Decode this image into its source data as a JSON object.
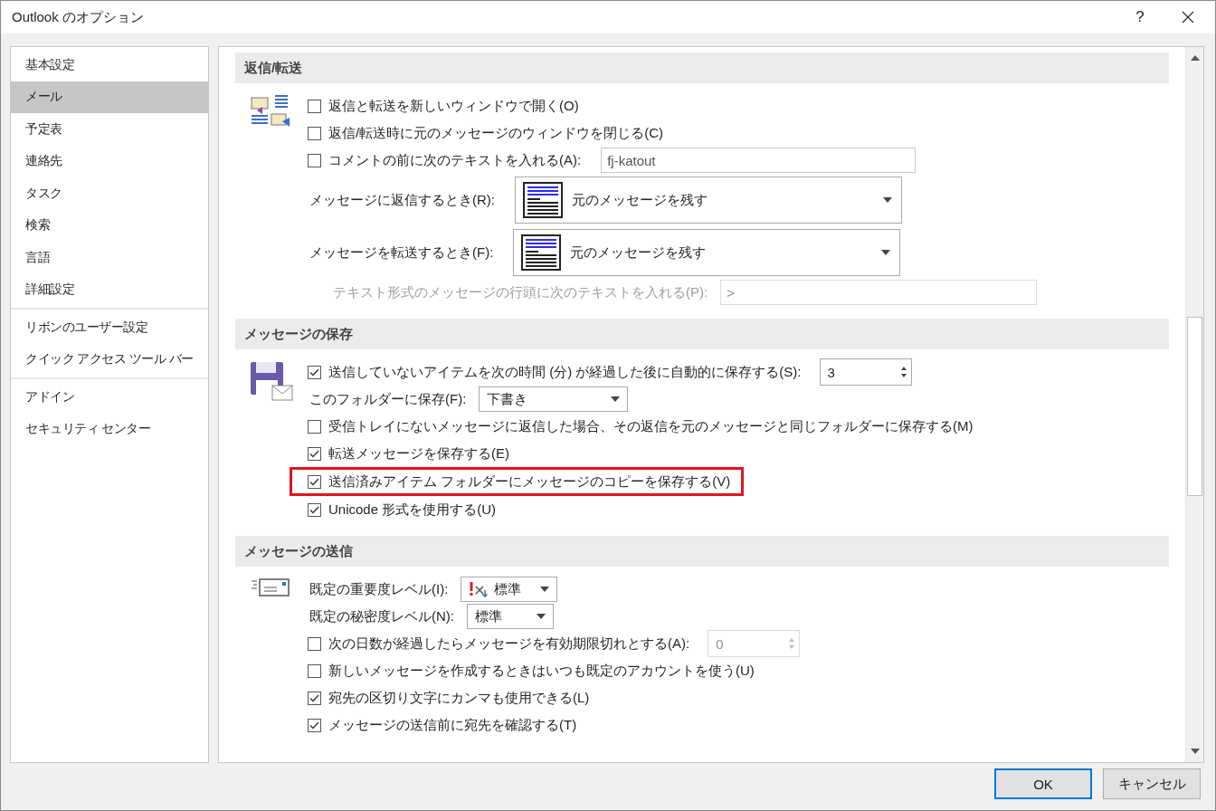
{
  "window": {
    "title": "Outlook のオプション",
    "help": "?"
  },
  "sidebar": {
    "groups": [
      {
        "items": [
          {
            "label": "基本設定",
            "selected": false
          },
          {
            "label": "メール",
            "selected": true
          },
          {
            "label": "予定表",
            "selected": false
          },
          {
            "label": "連絡先",
            "selected": false
          },
          {
            "label": "タスク",
            "selected": false
          },
          {
            "label": "検索",
            "selected": false
          },
          {
            "label": "言語",
            "selected": false
          },
          {
            "label": "詳細設定",
            "selected": false
          }
        ]
      },
      {
        "items": [
          {
            "label": "リボンのユーザー設定",
            "selected": false
          },
          {
            "label": "クイック アクセス ツール バー",
            "selected": false
          }
        ]
      },
      {
        "items": [
          {
            "label": "アドイン",
            "selected": false
          },
          {
            "label": "セキュリティ センター",
            "selected": false
          }
        ]
      }
    ]
  },
  "sections": [
    {
      "title": "返信/転送",
      "rows": [
        {
          "kind": "check",
          "label": "返信と転送を新しいウィンドウで開く(O)",
          "checked": false
        },
        {
          "kind": "check",
          "label": "返信/転送時に元のメッセージのウィンドウを閉じる(C)",
          "checked": false
        },
        {
          "kind": "check_text",
          "label": "コメントの前に次のテキストを入れる(A):",
          "checked": false,
          "value": "fj-katout"
        },
        {
          "kind": "preview_select",
          "label": "メッセージに返信するとき(R):",
          "value": "元のメッセージを残す"
        },
        {
          "kind": "preview_select",
          "label": "メッセージを転送するとき(F):",
          "value": "元のメッセージを残す"
        },
        {
          "kind": "text",
          "label": "テキスト形式のメッセージの行頭に次のテキストを入れる(P):",
          "value": ">",
          "disabled": true
        }
      ]
    },
    {
      "title": "メッセージの保存",
      "rows": [
        {
          "kind": "check_spin",
          "label": "送信していないアイテムを次の時間 (分) が経過した後に自動的に保存する(S):",
          "checked": true,
          "value": "3",
          "disabled": false
        },
        {
          "kind": "select",
          "label": "このフォルダーに保存(F):",
          "value": "下書き"
        },
        {
          "kind": "check",
          "label": "受信トレイにないメッセージに返信した場合、その返信を元のメッセージと同じフォルダーに保存する(M)",
          "checked": false
        },
        {
          "kind": "check",
          "label": "転送メッセージを保存する(E)",
          "checked": true
        },
        {
          "kind": "check",
          "label": "送信済みアイテム フォルダーにメッセージのコピーを保存する(V)",
          "checked": true,
          "highlighted": true
        },
        {
          "kind": "check",
          "label": "Unicode 形式を使用する(U)",
          "checked": true
        }
      ]
    },
    {
      "title": "メッセージの送信",
      "rows": [
        {
          "kind": "importance_select",
          "label": "既定の重要度レベル(I):",
          "value": "標準"
        },
        {
          "kind": "select",
          "label": "既定の秘密度レベル(N):",
          "value": "標準"
        },
        {
          "kind": "check_spin",
          "label": "次の日数が経過したらメッセージを有効期限切れとする(A):",
          "checked": false,
          "value": "0",
          "disabled": true
        },
        {
          "kind": "check",
          "label": "新しいメッセージを作成するときはいつも既定のアカウントを使う(U)",
          "checked": false
        },
        {
          "kind": "check",
          "label": "宛先の区切り文字にカンマも使用できる(L)",
          "checked": true
        },
        {
          "kind": "check",
          "label": "メッセージの送信前に宛先を確認する(T)",
          "checked": true
        }
      ]
    }
  ],
  "buttons": [
    {
      "label": "OK",
      "focused": true
    },
    {
      "label": "キャンセル",
      "focused": false
    }
  ]
}
